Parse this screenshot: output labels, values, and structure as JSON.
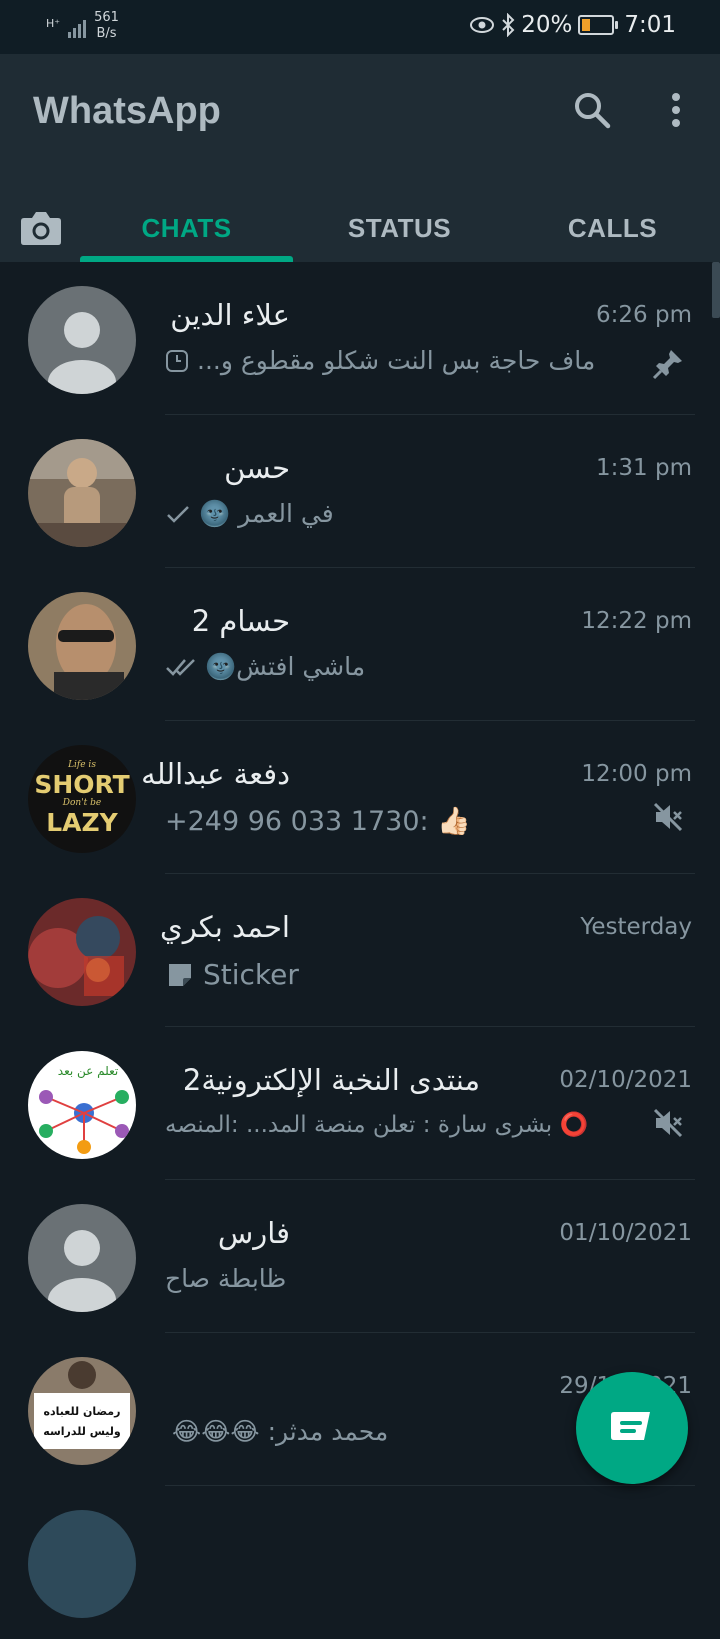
{
  "status_bar": {
    "network": "H⁺",
    "speed_value": "561",
    "speed_unit": "B/s",
    "battery": "20%",
    "time": "7:01"
  },
  "app": {
    "title": "WhatsApp"
  },
  "tabs": [
    {
      "label": "CHATS",
      "active": true
    },
    {
      "label": "STATUS",
      "active": false
    },
    {
      "label": "CALLS",
      "active": false
    }
  ],
  "chats": [
    {
      "name": "علاء الدين",
      "time": "6:26 pm",
      "preview": "ماف حاجة بس النت شكلو مقطوع و...",
      "pinned": true,
      "avatar": "default-avatar"
    },
    {
      "name": "حسن",
      "time": "1:31 pm",
      "preview": "في العمر 🌚",
      "tick": "single",
      "avatar": "photo"
    },
    {
      "name": "حسام 2",
      "time": "12:22 pm",
      "preview": "ماشي افتش🌚",
      "tick": "double",
      "avatar": "photo"
    },
    {
      "name": "دفعة عبدالله",
      "time": "12:00 pm",
      "preview": "+249 96 033 1730: 👍🏻",
      "muted": true,
      "avatar": "short-lazy"
    },
    {
      "name": "احمد بكري",
      "time": "Yesterday",
      "preview": "Sticker",
      "avatar": "photo"
    },
    {
      "name": "منتدى النخبة الإلكترونية2",
      "time": "02/10/2021",
      "preview": "⭕ بشرى سارة : تعلن منصة المد... :المنصه",
      "muted": true,
      "avatar": "network"
    },
    {
      "name": "فارس",
      "time": "01/10/2021",
      "preview": "ظابطة صاح",
      "avatar": "default-avatar"
    },
    {
      "name": "",
      "time": "29/10/2021",
      "preview": "محمد مدثر: 😂😂😂",
      "avatar": "sign-photo"
    }
  ],
  "avatar_text": {
    "short_top": "Life is",
    "short_main": "SHORT",
    "short_mid": "Don't be",
    "short_bottom": "LAZY",
    "sign_line1": "رمضان للعباده",
    "sign_line2": "وليس للدراسه",
    "network_text": "تعلم عن بعد"
  },
  "colors": {
    "accent": "#00a884",
    "background": "#121b22",
    "appbar": "#1f2c34"
  }
}
